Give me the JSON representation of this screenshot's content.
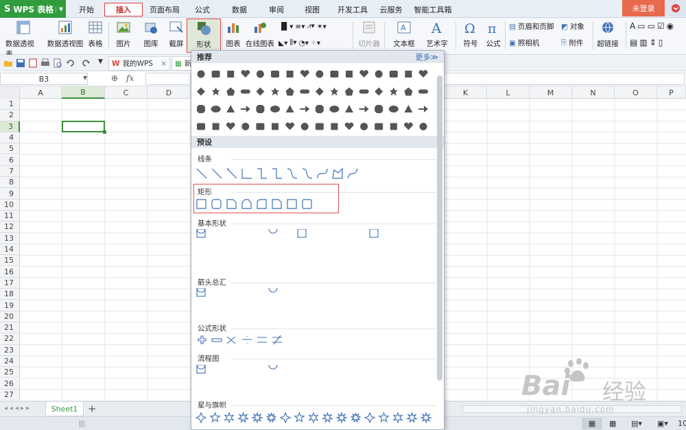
{
  "app": {
    "name": "WPS 表格",
    "login": "未登录"
  },
  "menu": {
    "items": [
      "开始",
      "插入",
      "页面布局",
      "公式",
      "数据",
      "审阅",
      "视图",
      "开发工具",
      "云服务",
      "智能工具箱"
    ],
    "active": "插入"
  },
  "ribbon": {
    "big": [
      "数据透视表",
      "数据透视图",
      "表格",
      "图片",
      "图库",
      "截屏",
      "形状",
      "图表",
      "在线图表",
      "切片器",
      "文本框",
      "艺术字",
      "符号",
      "公式",
      "超链接"
    ],
    "small": {
      "header_footer": "页眉和页脚",
      "object": "对象",
      "camera": "照相机",
      "attachment": "附件"
    }
  },
  "tabs": {
    "wps": "我的WPS",
    "new": "新"
  },
  "formula_bar": {
    "cell_ref": "B3",
    "fx": "fx"
  },
  "grid": {
    "columns": [
      "A",
      "B",
      "C",
      "D",
      "K",
      "L",
      "M",
      "N",
      "O",
      "P"
    ],
    "rows": [
      "1",
      "2",
      "3",
      "4",
      "5",
      "6",
      "7",
      "8",
      "9",
      "10",
      "11",
      "12",
      "13",
      "14",
      "15",
      "16",
      "17",
      "18",
      "19",
      "20",
      "21",
      "22",
      "23",
      "24",
      "25",
      "26",
      "27"
    ],
    "selected_cell": "B3"
  },
  "sheet_tab": "Sheet1",
  "status": {
    "zoom": "10"
  },
  "shapes_panel": {
    "recommend_title": "推荐",
    "more_label": "更多≫",
    "preset_title": "预设",
    "sections": [
      "线条",
      "矩形",
      "基本形状",
      "箭头总汇",
      "公式形状",
      "流程图",
      "星与旗帜"
    ],
    "highlighted_section": "矩形"
  },
  "watermark": {
    "brand": "Bai",
    "brand_cn": "经验",
    "url": "jingyan.baidu.com"
  },
  "colors": {
    "accent_green": "#2f9d3d",
    "highlight_red": "#e04040",
    "login_orange": "#e9694c",
    "selection_green": "#3a8f3a"
  }
}
